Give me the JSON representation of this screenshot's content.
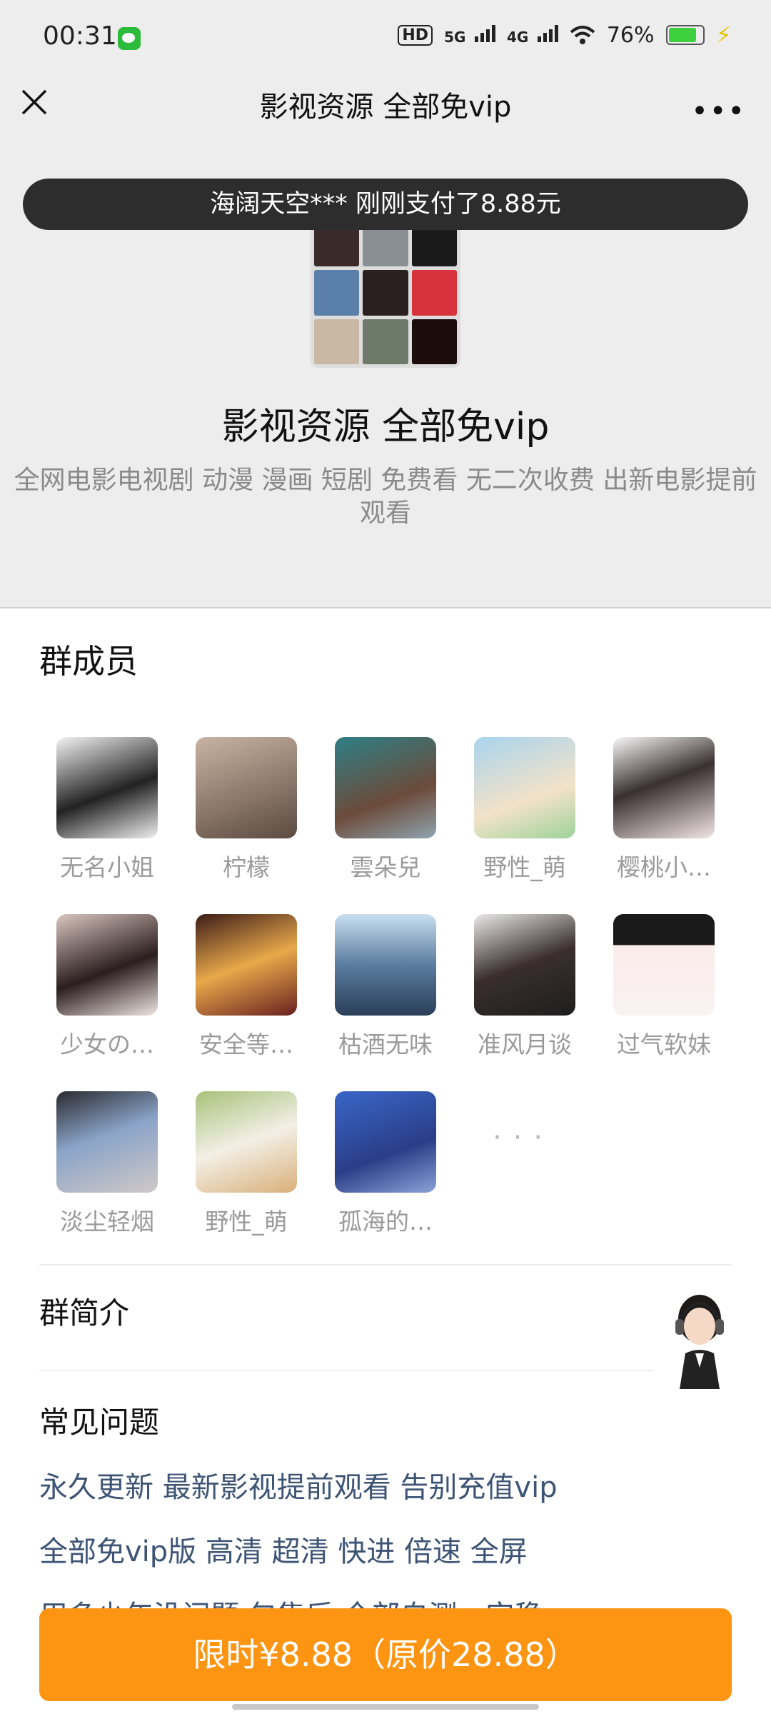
{
  "status_bar": {
    "time": "00:31",
    "hd_label": "HD",
    "signal_5g": "5G",
    "signal_4g": "4G",
    "battery_percent": "76%",
    "icons": [
      "wechat-icon",
      "hd-icon",
      "signal-5g-icon",
      "signal-4g-icon",
      "wifi-icon",
      "battery-icon",
      "charging-icon"
    ]
  },
  "nav": {
    "title": "影视资源 全部免vip",
    "close_icon": "close-icon",
    "more_icon": "more-icon"
  },
  "toast": {
    "text": "海阔天空*** 刚刚支付了8.88元"
  },
  "group": {
    "name": "影视资源 全部免vip",
    "description": "全网电影电视剧 动漫 漫画 短剧 免费看 无二次收费 出新电影提前观看"
  },
  "members_section": {
    "title": "群成员",
    "members": [
      {
        "name": "无名小姐"
      },
      {
        "name": "柠檬"
      },
      {
        "name": "雲朵兒"
      },
      {
        "name": "野性_萌"
      },
      {
        "name": "樱桃小…"
      },
      {
        "name": "少女の…"
      },
      {
        "name": "安全等…"
      },
      {
        "name": "枯酒无味"
      },
      {
        "name": "准风月谈"
      },
      {
        "name": "过气软妹"
      },
      {
        "name": "淡尘轻烟"
      },
      {
        "name": "野性_萌"
      },
      {
        "name": "孤海的…"
      }
    ],
    "more_label": "···"
  },
  "intro_section": {
    "title": "群简介",
    "cs_icon": "customer-service-icon"
  },
  "faq_section": {
    "title": "常见问题",
    "lines": [
      "永久更新 最新影视提前观看 告别充值vip",
      "全部免vip版 高清 超清 快进 倍速 全屏",
      "用多少年没问题 包售后 全部自测，完稳"
    ]
  },
  "buy_button": {
    "label": "限时¥8.88（原价28.88）"
  },
  "colors": {
    "accent": "#fd9412",
    "link": "#3d5475",
    "header_bg": "#ededed"
  }
}
